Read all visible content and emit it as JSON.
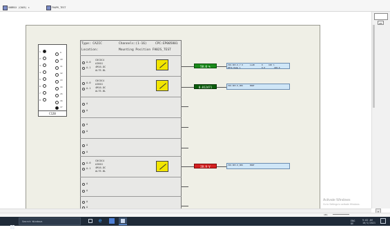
{
  "tabs": [
    {
      "label": "X0BRXX (CA05) ×"
    },
    {
      "label": "FHAPK_TEST"
    }
  ],
  "connector": {
    "label": "C120",
    "pins_left": [
      "1",
      "2",
      "3",
      "4",
      "5",
      "6",
      "7",
      "8"
    ],
    "pins_right": [
      "9",
      "10",
      "11",
      "12",
      "13",
      "14",
      "15",
      "16",
      "17"
    ]
  },
  "module": {
    "type_line": "Type: CA2IC",
    "channels_line": "Channels:(1-16)",
    "cpc_line": "CPC:EP005801",
    "location_line": "Location:",
    "mounting_line": "Mounting Position FH02S_TEST"
  },
  "slots": [
    {
      "ch_a": "A-0",
      "ch_b": "A-1",
      "line1": "C0C0C4",
      "line2": "AIN1G",
      "line3": "4M16-DC",
      "line4": "ALTE-BL",
      "sensor": true
    },
    {
      "ch_a": "A-0",
      "ch_b": "A-1",
      "line1": "C0C0C4",
      "line2": "AIN1G",
      "line3": "4M16-DC",
      "line4": "ALTE-BL",
      "sensor": true
    },
    {
      "ch_a": "A",
      "ch_b": "A",
      "line1": "",
      "line2": "",
      "line3": "",
      "line4": "",
      "sensor": false
    },
    {
      "ch_a": "A",
      "ch_b": "A",
      "line1": "",
      "line2": "",
      "line3": "",
      "line4": "",
      "sensor": false
    },
    {
      "ch_a": "A",
      "ch_b": "A",
      "line1": "",
      "line2": "",
      "line3": "",
      "line4": "",
      "sensor": false
    },
    {
      "ch_a": "A-0",
      "ch_b": "A-1",
      "line1": "C0C0C4",
      "line2": "AIN1G",
      "line3": "4M16-DC",
      "line4": "ALTE-BL",
      "sensor": true
    },
    {
      "ch_a": "A",
      "ch_b": "A",
      "line1": "",
      "line2": "",
      "line3": "",
      "line4": "",
      "sensor": false
    },
    {
      "ch_a": "A",
      "ch_b": "A",
      "line1": "",
      "line2": "",
      "line3": "",
      "line4": "",
      "sensor": false
    }
  ],
  "values": [
    {
      "text": "50.0 %",
      "color": "#1a8a1a",
      "border": "#0d4d0d"
    },
    {
      "text": "0.012471",
      "color": "#0b5c0b",
      "border": "#063306"
    },
    {
      "text": "28.9 V",
      "color": "#d42020",
      "border": "#7a0c0c"
    }
  ],
  "info_boxes": [
    {
      "a": "VS0.003.0_7 0",
      "b": "LLAB",
      "c": "0",
      "d": "100 %",
      "e": "DETA Ramp 1",
      "f": "0.0",
      "g": "100.0"
    },
    {
      "a": "VS0.003.0_006",
      "b": "MANT",
      "c": "",
      "d": "",
      "e": "",
      "f": "",
      "g": ""
    },
    {
      "a": "VS0.003.0_006",
      "b": "MANT",
      "c": "",
      "d": "",
      "e": "",
      "f": "",
      "g": ""
    }
  ],
  "watermark": {
    "title": "Activate Windows",
    "subtitle": "Go to Settings to activate Windows."
  },
  "zoom": {
    "label": "16%"
  },
  "taskbar": {
    "search_placeholder": "Search Windows",
    "lang": "ENG",
    "region": "DE",
    "time": "9:02 AM",
    "date": "10/1/2021"
  },
  "side_panel": {
    "button_label": "OFF"
  },
  "colors": {
    "sensor": "#f2e500",
    "sheet": "#efefe6",
    "taskbar": "#1f2a38"
  }
}
